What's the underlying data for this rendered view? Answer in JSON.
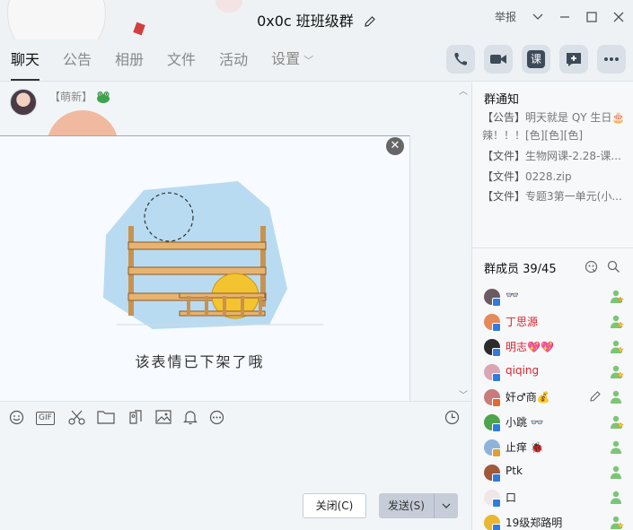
{
  "window": {
    "title": "0x0c 班班级群",
    "report_label": "举报"
  },
  "tabs": [
    {
      "label": "聊天",
      "active": true
    },
    {
      "label": "公告"
    },
    {
      "label": "相册"
    },
    {
      "label": "文件"
    },
    {
      "label": "活动"
    },
    {
      "label": "设置"
    }
  ],
  "action_icons": [
    "phone-icon",
    "video-call-icon",
    "class-icon",
    "add-app-icon",
    "more-icon"
  ],
  "action_class_label": "课",
  "message": {
    "sender": "【萌新】",
    "sticker_caption": "该表情已下架了哦"
  },
  "toolbar_icons": [
    "emoji-icon",
    "gif-icon",
    "scissors-icon",
    "folder-icon",
    "file-transfer-icon",
    "image-icon",
    "bell-icon",
    "more-circle-icon",
    "history-clock-icon"
  ],
  "toolbar_gif_label": "GIF",
  "input": {
    "close_label": "关闭(C)",
    "send_label": "发送(S)"
  },
  "notice": {
    "title": "群通知",
    "items": [
      {
        "tag": "【公告】",
        "text": "明天就是 QY 生日🎂辣！！！[色][色][色]"
      },
      {
        "tag": "【文件】",
        "text": "生物网课-2.28-课..."
      },
      {
        "tag": "【文件】",
        "text": "0228.zip"
      },
      {
        "tag": "【文件】",
        "text": "专题3第一单元(小..."
      }
    ]
  },
  "members": {
    "title": "群成员 39/45",
    "list": [
      {
        "name": "👓",
        "red": false,
        "role": "owner"
      },
      {
        "name": "丁思源",
        "red": true,
        "role": "admin"
      },
      {
        "name": "明志💖💖",
        "red": true,
        "role": "admin"
      },
      {
        "name": "qiqing",
        "red": true,
        "role": "admin"
      },
      {
        "name": "奸♂商💰",
        "red": false,
        "role": "member",
        "editable": true
      },
      {
        "name": "小跳 👓",
        "red": false,
        "role": "admin"
      },
      {
        "name": "止痒 🐞",
        "red": false,
        "role": "member"
      },
      {
        "name": "Ptk",
        "red": false,
        "role": "member"
      },
      {
        "name": "口",
        "red": false,
        "role": "member"
      },
      {
        "name": "19级郑路明",
        "red": false,
        "role": "admin"
      }
    ]
  },
  "colors": {
    "accent": "#e0242c",
    "background": "#eef2f5",
    "send_button": "#c6ccd8"
  }
}
